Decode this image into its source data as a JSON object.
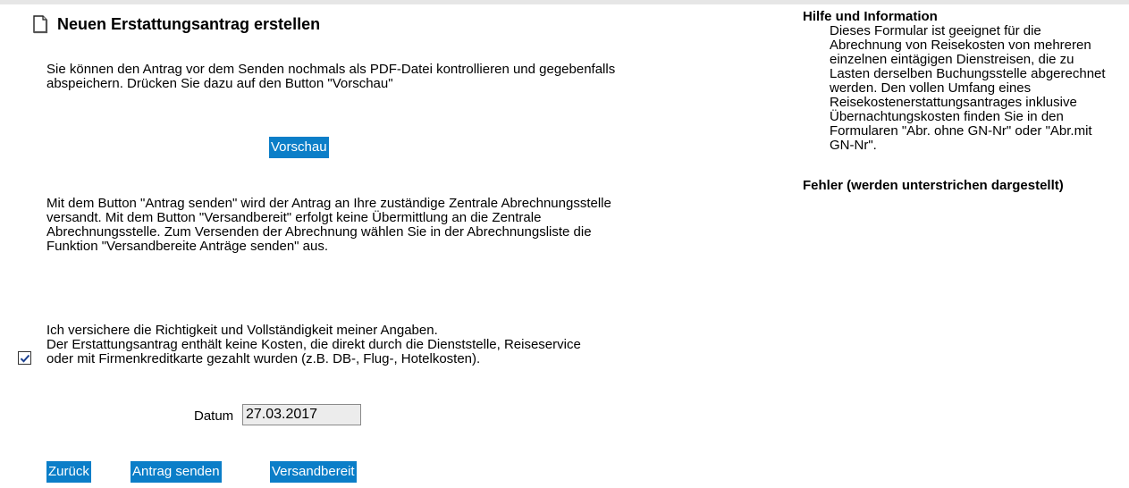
{
  "form": {
    "title": "Neuen Erstattungsantrag erstellen",
    "icon": "document-icon",
    "preview_intro": "Sie können den Antrag vor dem Senden nochmals als PDF-Datei kontrollieren und gegebenfalls abspeichern. Drücken Sie dazu auf den Button \"Vorschau\"",
    "preview_button": "Vorschau",
    "send_info": "Mit dem Button \"Antrag senden\" wird der Antrag an Ihre zuständige Zentrale Abrechnungsstelle versandt. Mit dem Button \"Versandbereit\" erfolgt keine Übermittlung an die Zentrale Abrechnungsstelle. Zum Versenden der Abrechnung wählen Sie in der Abrechnungsliste die Funktion \"Versandbereite Anträge senden\" aus.",
    "confirmation": {
      "checked": true,
      "line1": "Ich versichere die Richtigkeit und Vollständigkeit meiner Angaben.",
      "line2": "Der Erstattungsantrag enthält keine Kosten, die direkt durch die Dienststelle, Reiseservice oder mit Firmenkreditkarte gezahlt wurden (z.B. DB-, Flug-, Hotelkosten)."
    },
    "date_label": "Datum",
    "date_value": "27.03.2017",
    "buttons": {
      "back": "Zurück",
      "send": "Antrag senden",
      "ready": "Versandbereit"
    },
    "button_color": "#0b7ec8"
  },
  "help": {
    "title": "Hilfe und Information",
    "text": "Dieses Formular ist geeignet für die Abrechnung von Reisekosten von mehreren einzelnen eintägigen Dienstreisen, die zu Lasten derselben Buchungsstelle abgerechnet werden. Den vollen Umfang eines Reisekostenerstattungsantrages inklusive Übernachtungskosten finden Sie in den Formularen \"Abr. ohne GN-Nr\" oder \"Abr.mit GN-Nr\".",
    "errors_title": "Fehler (werden unterstrichen dargestellt)"
  }
}
